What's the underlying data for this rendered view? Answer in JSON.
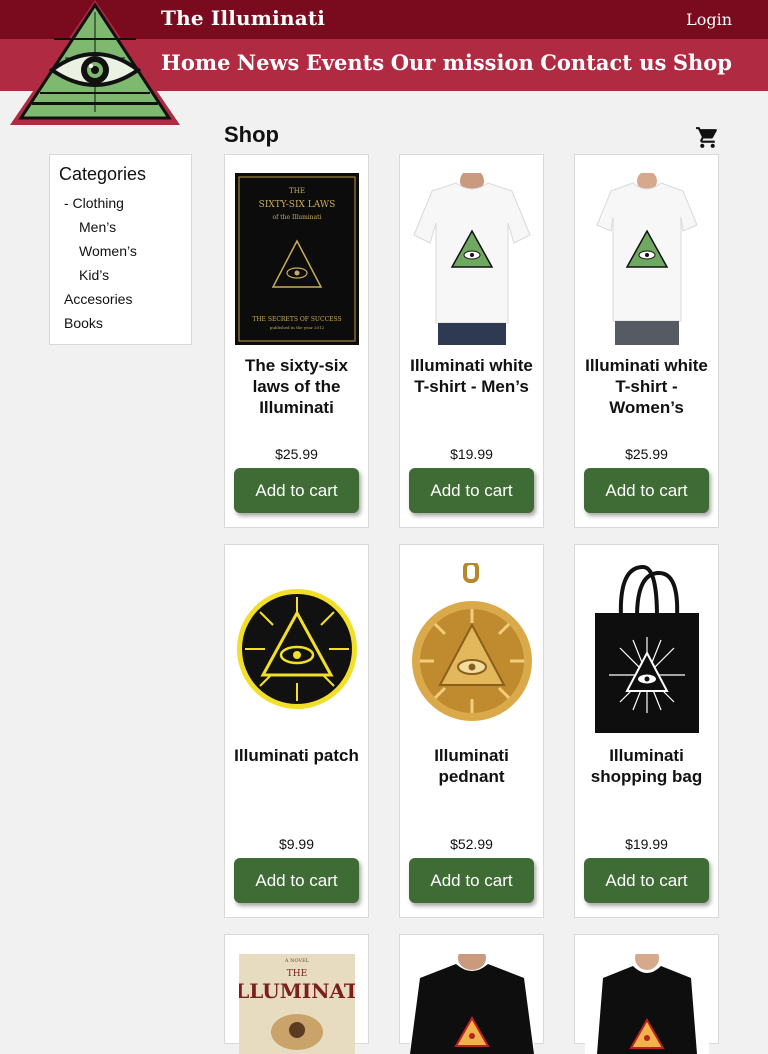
{
  "header": {
    "site_title": "The Illuminati",
    "login_label": "Login",
    "nav": [
      "Home",
      "News",
      "Events",
      "Our mission",
      "Contact us",
      "Shop"
    ],
    "top_color": "#7a0b1e",
    "nav_color": "#b02a42"
  },
  "sidebar": {
    "heading": "Categories",
    "items": [
      "- Clothing",
      "Men’s",
      "Women’s",
      "Kid’s",
      "Accesories",
      "Books"
    ]
  },
  "main": {
    "title": "Shop",
    "cart_icon": "shopping-cart-icon",
    "button_color": "#3f6b34",
    "products": [
      {
        "name": "The sixty-six laws of the Illuminati",
        "price": "$25.99",
        "button": "Add to cart",
        "image": "book-icon",
        "book_title": "THE",
        "book_title2": "SIXTY-SIX LAWS",
        "book_sub": "of the Illuminati",
        "book_footer": "THE SECRETS OF SUCCESS",
        "book_footer2": "published in the year 2012"
      },
      {
        "name": "Illuminati white T-shirt - Men’s",
        "price": "$19.99",
        "button": "Add to cart",
        "image": "mens-tshirt-icon"
      },
      {
        "name": "Illuminati white T-shirt - Women’s",
        "price": "$25.99",
        "button": "Add to cart",
        "image": "womens-tshirt-icon"
      },
      {
        "name": "Illuminati patch",
        "price": "$9.99",
        "button": "Add to cart",
        "image": "patch-icon"
      },
      {
        "name": "Illuminati pednant",
        "price": "$52.99",
        "button": "Add to cart",
        "image": "pendant-icon"
      },
      {
        "name": "Illuminati shopping bag",
        "price": "$19.99",
        "button": "Add to cart",
        "image": "tote-bag-icon"
      },
      {
        "name": "",
        "price": "",
        "button": "",
        "image": "novel-cover-icon",
        "cover_top": "A NOVEL",
        "cover_title": "THE",
        "cover_title2": "ILLUMINATI"
      },
      {
        "name": "",
        "price": "",
        "button": "",
        "image": "mens-black-tshirt-icon"
      },
      {
        "name": "",
        "price": "",
        "button": "",
        "image": "womens-black-tshirt-icon"
      }
    ]
  }
}
